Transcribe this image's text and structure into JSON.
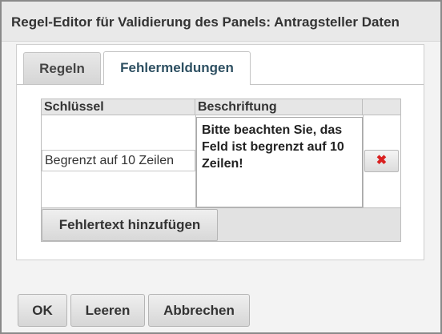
{
  "window": {
    "title": "Regel-Editor für Validierung des Panels: Antragsteller Daten"
  },
  "tabs": [
    {
      "label": "Regeln",
      "active": false
    },
    {
      "label": "Fehlermeldungen",
      "active": true
    }
  ],
  "table": {
    "headers": {
      "key": "Schlüssel",
      "label": "Beschriftung",
      "action": ""
    },
    "rows": [
      {
        "key": "Begrenzt auf 10 Zeilen",
        "label": "Bitte beachten Sie, das Feld ist begrenzt auf 10 Zeilen!",
        "delete_icon": "close-x-icon",
        "delete_symbol": "✖"
      }
    ],
    "add_button": "Fehlertext hinzufügen"
  },
  "buttons": {
    "ok": "OK",
    "clear": "Leeren",
    "cancel": "Abbrechen"
  },
  "colors": {
    "active_tab_text": "#2e5062",
    "delete_icon": "#d92020"
  }
}
